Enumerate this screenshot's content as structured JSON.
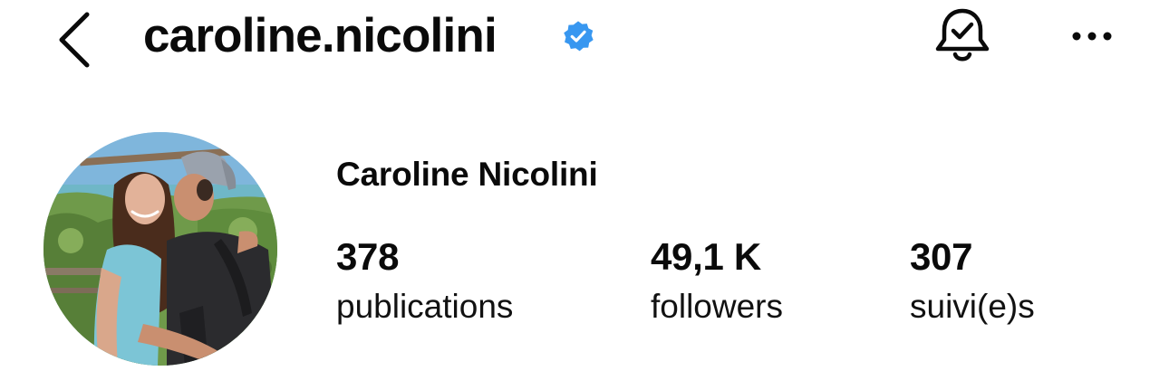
{
  "header": {
    "username": "caroline.nicolini",
    "verified": true,
    "icons": {
      "back": "chevron-left-icon",
      "verified": "verified-badge-icon",
      "notifications": "bell-check-icon",
      "more": "more-horizontal-icon"
    },
    "accent_color": "#3897f0"
  },
  "profile": {
    "full_name": "Caroline Nicolini",
    "stats": {
      "posts": {
        "value": "378",
        "label": "publications"
      },
      "followers": {
        "value": "49,1 K",
        "label": "followers"
      },
      "following": {
        "value": "307",
        "label": "suivi(e)s"
      }
    }
  }
}
